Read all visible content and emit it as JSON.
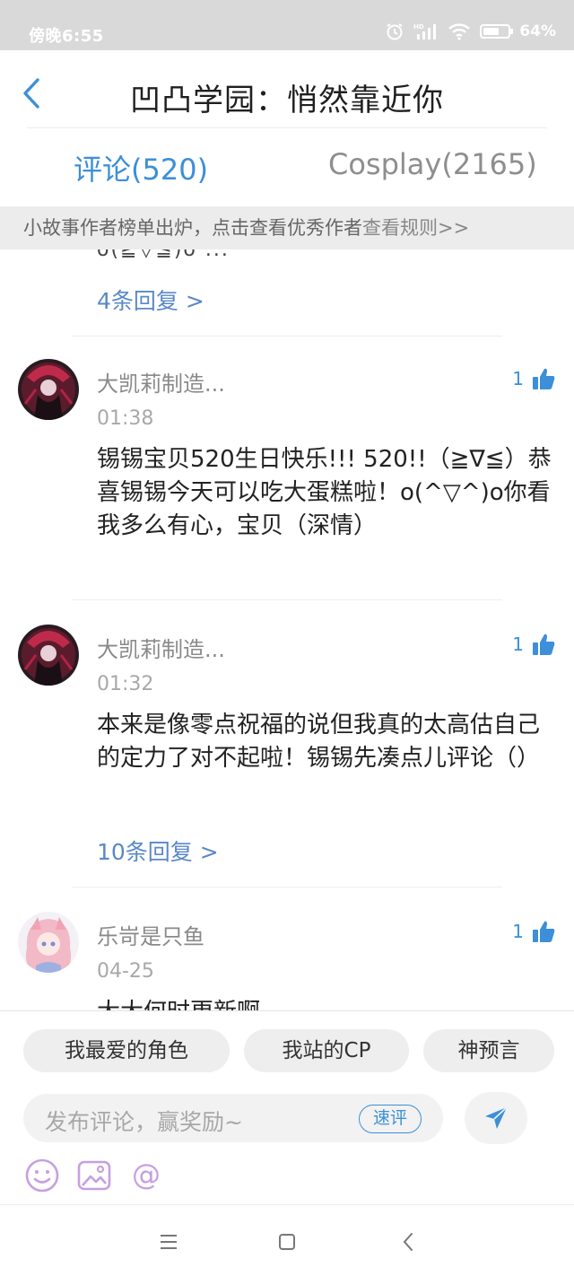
{
  "status_bar": {
    "time": "傍晚6:55",
    "battery": "64%"
  },
  "header": {
    "title": "凹凸学园：悄然靠近你"
  },
  "tabs": [
    {
      "label": "评论(520)",
      "active": true
    },
    {
      "label": "Cosplay(2165)",
      "active": false
    }
  ],
  "banner": {
    "text": "小故事作者榜单出炉，点击查看优秀作者",
    "link": "查看规则>>"
  },
  "feed": {
    "partial_text": "o(≧▽≦)o ...",
    "first_replies": "4条回复 >",
    "comments": [
      {
        "name": "大凯莉制造...",
        "time": "01:38",
        "likes": "1",
        "body": "锡锡宝贝520生日快乐!!! 520!!（≧∇≦）恭喜锡锡今天可以吃大蛋糕啦！o(^▽^)o你看我多么有心，宝贝（深情）"
      },
      {
        "name": "大凯莉制造...",
        "time": "01:32",
        "likes": "1",
        "body": "本来是像零点祝福的说但我真的太高估自己的定力了对不起啦！锡锡先凑点儿评论（）",
        "replies": "10条回复 >"
      },
      {
        "name": "乐岢是只鱼",
        "time": "04-25",
        "likes": "1",
        "body": "大大何时更新啊"
      }
    ]
  },
  "quick_chips": [
    "我最爱的角色",
    "我站的CP",
    "神预言"
  ],
  "composer": {
    "placeholder": "发布评论，赢奖励~",
    "quick_label": "速评"
  },
  "colors": {
    "accent": "#3c8fd8",
    "link": "#5a88c8"
  }
}
